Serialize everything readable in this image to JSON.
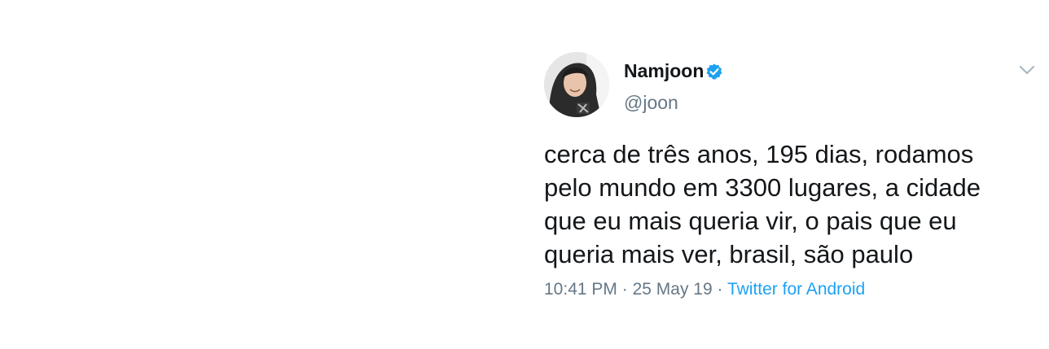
{
  "tweet": {
    "author": {
      "display_name": "Namjoon",
      "handle": "@joon",
      "verified": true,
      "avatar_icon": "profile-photo",
      "verified_icon": "verified-badge-icon"
    },
    "menu_icon": "chevron-down-icon",
    "text_lines": [
      "cerca de três anos, 195 dias, rodamos",
      "pelo mundo em 3300 lugares, a cidade",
      "que eu mais queria vir, o pais que eu",
      "queria mais ver, brasil, são paulo"
    ],
    "time": "10:41 PM",
    "separator": "·",
    "date": "25 May 19",
    "source": "Twitter for Android"
  },
  "colors": {
    "text": "#14171a",
    "secondary": "#657786",
    "accent": "#1da1f2"
  }
}
